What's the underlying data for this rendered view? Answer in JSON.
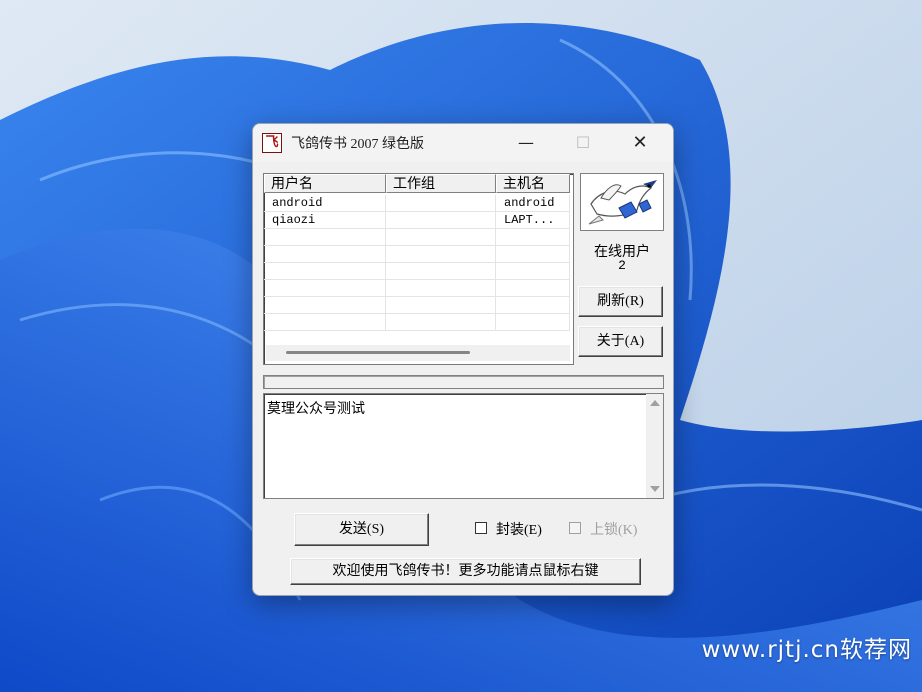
{
  "colors": {
    "desktop_bg": "#1d5ed8",
    "window_bg": "#f0f0f0",
    "disabled_text": "#a0a0a0"
  },
  "watermark": "www.rjtj.cn软荐网",
  "window": {
    "title": "飞鸽传书 2007 绿色版",
    "icon": "feige-app-icon",
    "controls": {
      "minimize": "minimize-icon",
      "maximize": "maximize-icon",
      "close": "close-icon"
    }
  },
  "user_list": {
    "columns": [
      "用户名",
      "工作组",
      "主机名"
    ],
    "rows": [
      {
        "user": "android",
        "group": "",
        "host": "android"
      },
      {
        "user": "qiaozi",
        "group": "",
        "host": "LAPT..."
      }
    ]
  },
  "side_panel": {
    "logo": "pigeon-logo-icon",
    "online_label": "在线用户",
    "online_count": "2",
    "refresh_label": "刷新(R)",
    "about_label": "关于(A)"
  },
  "message": {
    "text": "莫理公众号测试"
  },
  "actions": {
    "send_label": "发送(S)",
    "seal_label": "封装(E)",
    "seal_checked": false,
    "lock_label": "上锁(K)",
    "lock_checked": false,
    "lock_enabled": false,
    "status_text": "欢迎使用飞鸽传书！更多功能请点鼠标右键"
  }
}
